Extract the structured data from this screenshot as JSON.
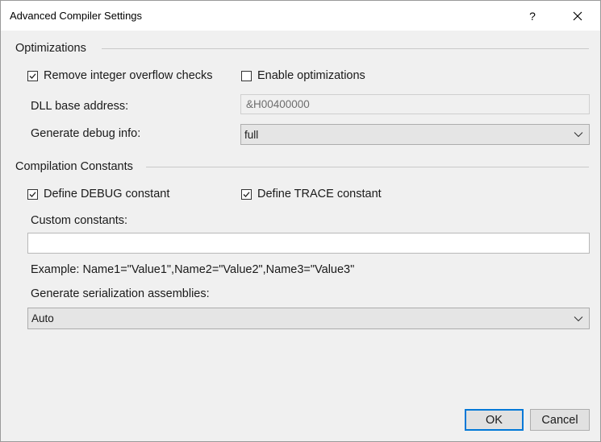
{
  "window": {
    "title": "Advanced Compiler Settings",
    "help_label": "?"
  },
  "optimizations": {
    "header": "Optimizations",
    "remove_overflow_label": "Remove integer overflow checks",
    "remove_overflow_checked": true,
    "enable_opt_label": "Enable optimizations",
    "enable_opt_checked": false,
    "dll_base_label": "DLL base address:",
    "dll_base_value": "&H00400000",
    "debug_info_label": "Generate debug info:",
    "debug_info_value": "full"
  },
  "constants": {
    "header": "Compilation Constants",
    "define_debug_label": "Define DEBUG constant",
    "define_debug_checked": true,
    "define_trace_label": "Define TRACE constant",
    "define_trace_checked": true,
    "custom_label": "Custom constants:",
    "custom_value": "",
    "example_text": "Example: Name1=\"Value1\",Name2=\"Value2\",Name3=\"Value3\"",
    "serialization_label": "Generate serialization assemblies:",
    "serialization_value": "Auto"
  },
  "buttons": {
    "ok_label": "OK",
    "cancel_label": "Cancel"
  },
  "colors": {
    "accent": "#0078d7",
    "window_bg": "#f0f0f0",
    "titlebar_bg": "#ffffff"
  },
  "icons": {
    "close": "close-icon",
    "checkmark": "checkmark-icon",
    "dropdown": "chevron-down-icon"
  }
}
